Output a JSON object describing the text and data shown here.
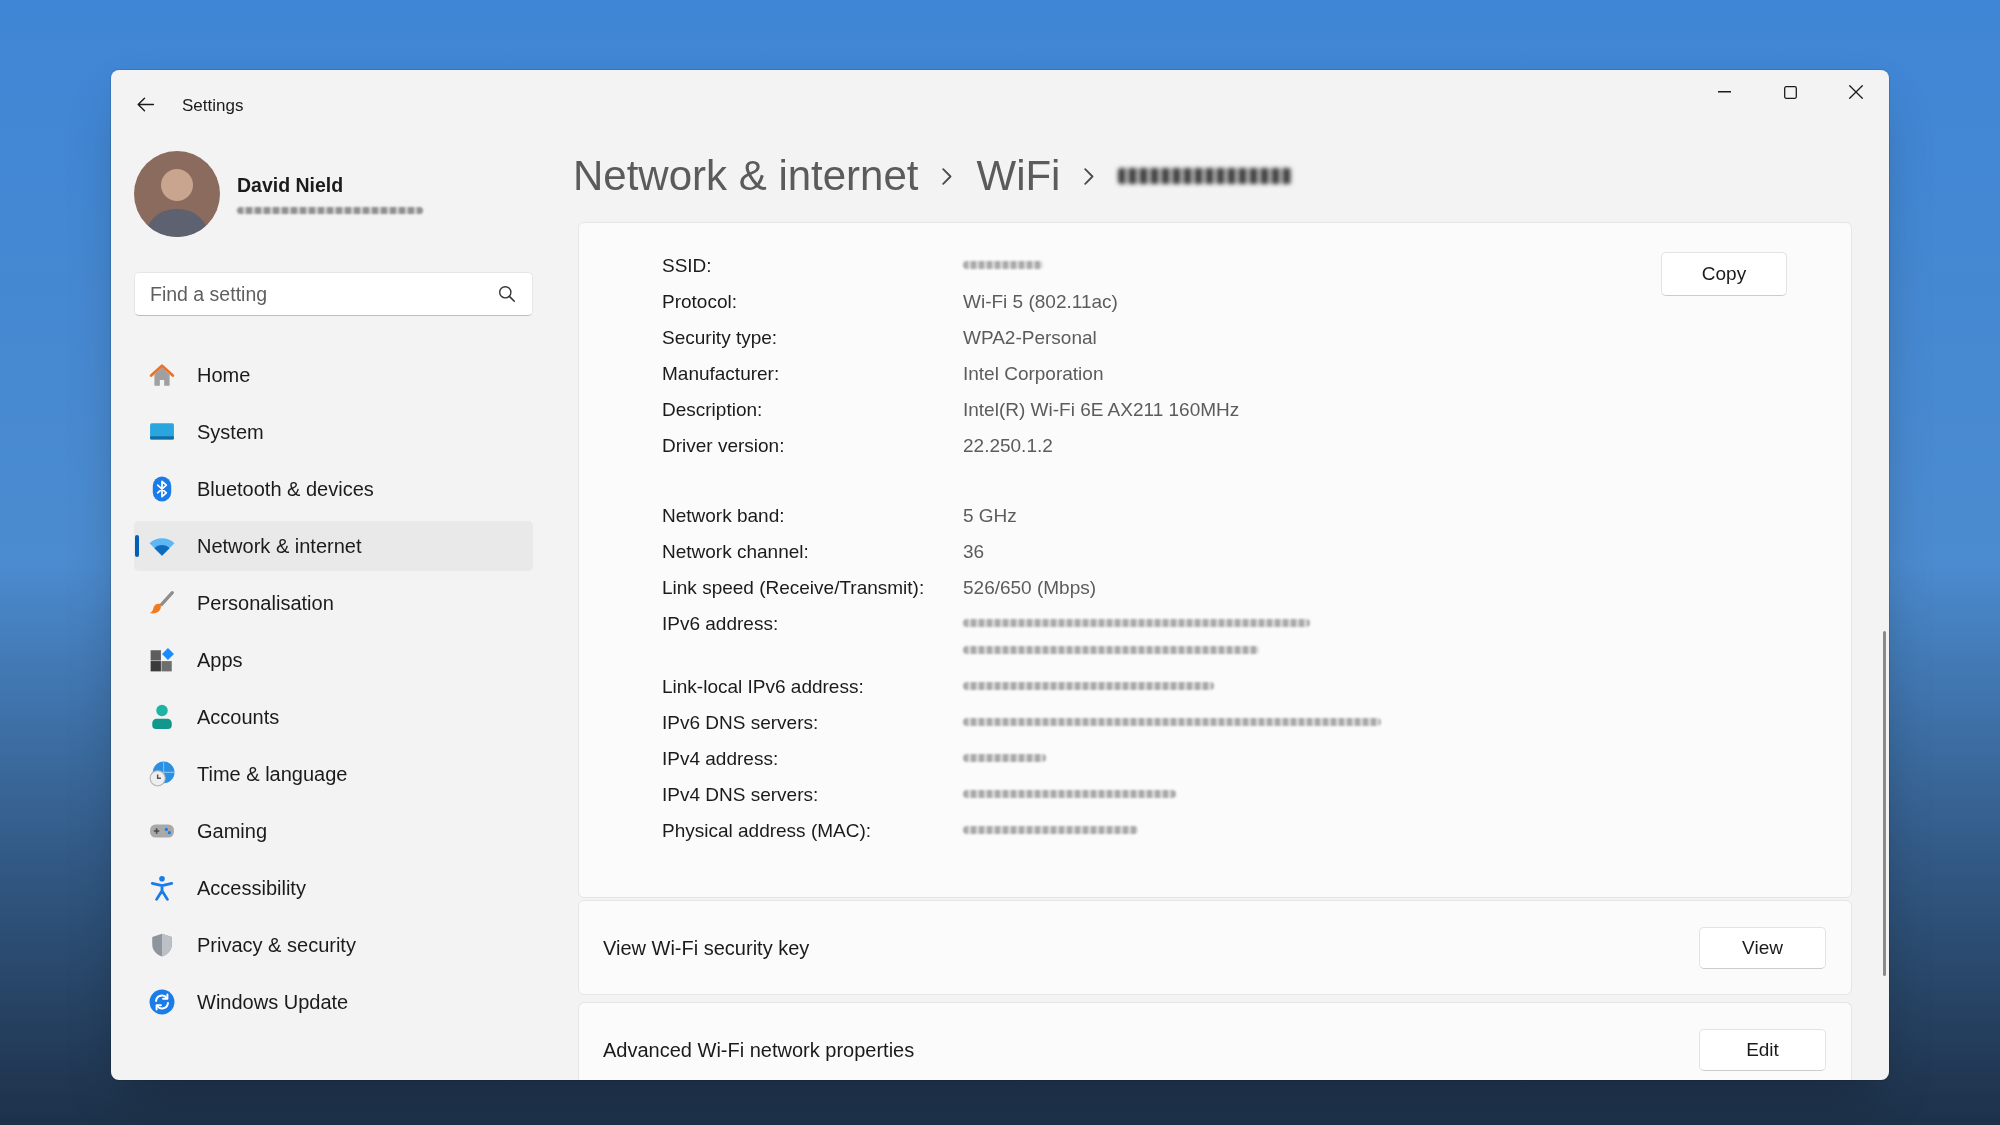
{
  "window": {
    "title": "Settings"
  },
  "account": {
    "name": "David Nield",
    "email_redacted": true
  },
  "search": {
    "placeholder": "Find a setting"
  },
  "sidebar": {
    "items": [
      {
        "label": "Home",
        "selected": false
      },
      {
        "label": "System",
        "selected": false
      },
      {
        "label": "Bluetooth & devices",
        "selected": false
      },
      {
        "label": "Network & internet",
        "selected": true
      },
      {
        "label": "Personalisation",
        "selected": false
      },
      {
        "label": "Apps",
        "selected": false
      },
      {
        "label": "Accounts",
        "selected": false
      },
      {
        "label": "Time & language",
        "selected": false
      },
      {
        "label": "Gaming",
        "selected": false
      },
      {
        "label": "Accessibility",
        "selected": false
      },
      {
        "label": "Privacy & security",
        "selected": false
      },
      {
        "label": "Windows Update",
        "selected": false
      }
    ]
  },
  "breadcrumb": [
    {
      "text": "Network & internet",
      "redacted": false
    },
    {
      "text": "WiFi",
      "redacted": false
    },
    {
      "redacted": true
    }
  ],
  "details": {
    "copy_button": "Copy",
    "groups": [
      {
        "rows": [
          {
            "label": "SSID:",
            "redacted": true
          },
          {
            "label": "Protocol:",
            "redacted": false,
            "value": "Wi-Fi 5 (802.11ac)"
          },
          {
            "label": "Security type:",
            "redacted": false,
            "value": "WPA2-Personal"
          },
          {
            "label": "Manufacturer:",
            "redacted": false,
            "value": "Intel Corporation"
          },
          {
            "label": "Description:",
            "redacted": false,
            "value": "Intel(R) Wi-Fi 6E AX211 160MHz"
          },
          {
            "label": "Driver version:",
            "redacted": false,
            "value": "22.250.1.2"
          }
        ]
      },
      {
        "rows": [
          {
            "label": "Network band:",
            "redacted": false,
            "value": "5 GHz"
          },
          {
            "label": "Network channel:",
            "redacted": false,
            "value": "36"
          },
          {
            "label": "Link speed (Receive/Transmit):",
            "redacted": false,
            "value": "526/650 (Mbps)"
          },
          {
            "label": "IPv6 address:",
            "redacted": true,
            "wrapped": true
          },
          {
            "label": "Link-local IPv6 address:",
            "redacted": true
          },
          {
            "label": "IPv6 DNS servers:",
            "redacted": true
          },
          {
            "label": "IPv4 address:",
            "redacted": true
          },
          {
            "label": "IPv4 DNS servers:",
            "redacted": true
          },
          {
            "label": "Physical address (MAC):",
            "redacted": true
          }
        ]
      }
    ]
  },
  "cards": [
    {
      "label": "View Wi-Fi security key",
      "button": "View"
    },
    {
      "label": "Advanced Wi-Fi network properties",
      "button": "Edit"
    }
  ]
}
